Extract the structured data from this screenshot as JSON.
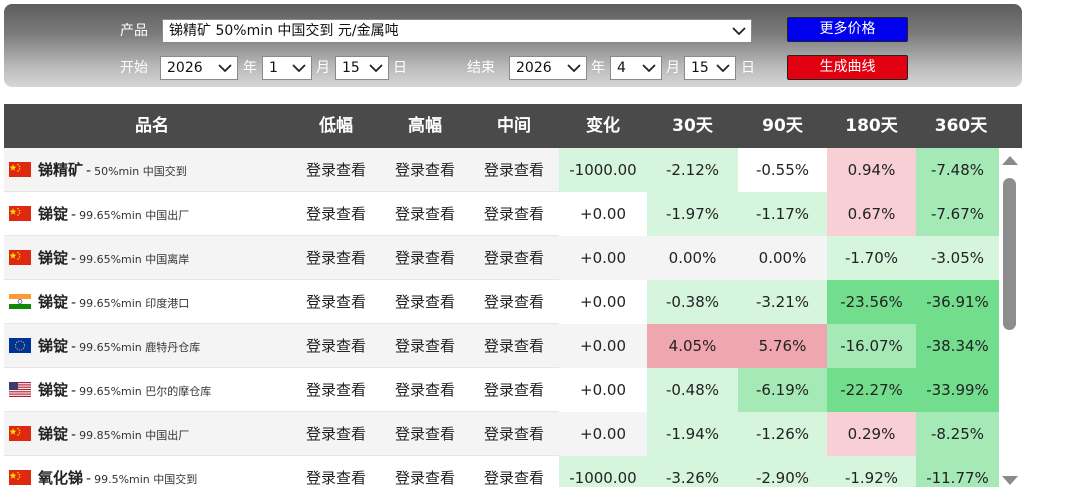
{
  "controls": {
    "product_label": "产品",
    "product_value": "锑精矿 50%min 中国交到 元/金属吨",
    "start_label": "开始",
    "end_label": "结束",
    "start": {
      "year": "2026",
      "year_unit": "年",
      "month": "1",
      "month_unit": "月",
      "day": "15",
      "day_unit": "日"
    },
    "end": {
      "year": "2026",
      "year_unit": "年",
      "month": "4",
      "month_unit": "月",
      "day": "15",
      "day_unit": "日"
    },
    "more_prices_button": "更多价格",
    "generate_curve_button": "生成曲线"
  },
  "table": {
    "headers": [
      "品名",
      "低幅",
      "高幅",
      "中间",
      "变化",
      "30天",
      "90天",
      "180天",
      "360天"
    ],
    "rows": [
      {
        "flag": "cn",
        "name": "锑精矿",
        "spec": "50%min 中国交到",
        "low": "登录查看",
        "high": "登录查看",
        "mid": "登录查看",
        "change": "-1000.00",
        "d30": "-2.12%",
        "d90": "-0.55%",
        "d180": "0.94%",
        "d360": "-7.48%",
        "colors": {
          "change": "#d6f5dd",
          "d30": "#d6f5dd",
          "d90": "#ffffff",
          "d180": "#f7cfd4",
          "d360": "#a4e9b6"
        }
      },
      {
        "flag": "cn",
        "name": "锑锭",
        "spec": "99.65%min 中国出厂",
        "low": "登录查看",
        "high": "登录查看",
        "mid": "登录查看",
        "change": "+0.00",
        "d30": "-1.97%",
        "d90": "-1.17%",
        "d180": "0.67%",
        "d360": "-7.67%",
        "colors": {
          "change": "#ffffff",
          "d30": "#d6f5dd",
          "d90": "#d6f5dd",
          "d180": "#f7cfd4",
          "d360": "#a4e9b6"
        }
      },
      {
        "flag": "cn",
        "name": "锑锭",
        "spec": "99.65%min 中国离岸",
        "low": "登录查看",
        "high": "登录查看",
        "mid": "登录查看",
        "change": "+0.00",
        "d30": "0.00%",
        "d90": "0.00%",
        "d180": "-1.70%",
        "d360": "-3.05%",
        "colors": {
          "change": "#f4f4f4",
          "d30": "#f4f4f4",
          "d90": "#f4f4f4",
          "d180": "#d6f5dd",
          "d360": "#d6f5dd"
        }
      },
      {
        "flag": "in",
        "name": "锑锭",
        "spec": "99.65%min 印度港口",
        "low": "登录查看",
        "high": "登录查看",
        "mid": "登录查看",
        "change": "+0.00",
        "d30": "-0.38%",
        "d90": "-3.21%",
        "d180": "-23.56%",
        "d360": "-36.91%",
        "colors": {
          "change": "#ffffff",
          "d30": "#d6f5dd",
          "d90": "#d6f5dd",
          "d180": "#72dd8c",
          "d360": "#72dd8c"
        }
      },
      {
        "flag": "eu",
        "name": "锑锭",
        "spec": "99.65%min 鹿特丹仓库",
        "low": "登录查看",
        "high": "登录查看",
        "mid": "登录查看",
        "change": "+0.00",
        "d30": "4.05%",
        "d90": "5.76%",
        "d180": "-16.07%",
        "d360": "-38.34%",
        "colors": {
          "change": "#f4f4f4",
          "d30": "#f0a6ae",
          "d90": "#f0a6ae",
          "d180": "#a4e9b6",
          "d360": "#72dd8c"
        }
      },
      {
        "flag": "us",
        "name": "锑锭",
        "spec": "99.65%min 巴尔的摩仓库",
        "low": "登录查看",
        "high": "登录查看",
        "mid": "登录查看",
        "change": "+0.00",
        "d30": "-0.48%",
        "d90": "-6.19%",
        "d180": "-22.27%",
        "d360": "-33.99%",
        "colors": {
          "change": "#ffffff",
          "d30": "#d6f5dd",
          "d90": "#a4e9b6",
          "d180": "#72dd8c",
          "d360": "#72dd8c"
        }
      },
      {
        "flag": "cn",
        "name": "锑锭",
        "spec": "99.85%min 中国出厂",
        "low": "登录查看",
        "high": "登录查看",
        "mid": "登录查看",
        "change": "+0.00",
        "d30": "-1.94%",
        "d90": "-1.26%",
        "d180": "0.29%",
        "d360": "-8.25%",
        "colors": {
          "change": "#f4f4f4",
          "d30": "#d6f5dd",
          "d90": "#d6f5dd",
          "d180": "#f7cfd4",
          "d360": "#a4e9b6"
        }
      },
      {
        "flag": "cn",
        "name": "氧化锑",
        "spec": "99.5%min 中国交到",
        "low": "登录查看",
        "high": "登录查看",
        "mid": "登录查看",
        "change": "-1000.00",
        "d30": "-3.26%",
        "d90": "-2.90%",
        "d180": "-1.92%",
        "d360": "-11.77%",
        "colors": {
          "change": "#d6f5dd",
          "d30": "#d6f5dd",
          "d90": "#d6f5dd",
          "d180": "#d6f5dd",
          "d360": "#a4e9b6"
        }
      }
    ]
  },
  "icons": {
    "dropdown": "chevron-down-icon",
    "scroll_up": "arrow-up-icon",
    "scroll_down": "arrow-down-icon"
  }
}
